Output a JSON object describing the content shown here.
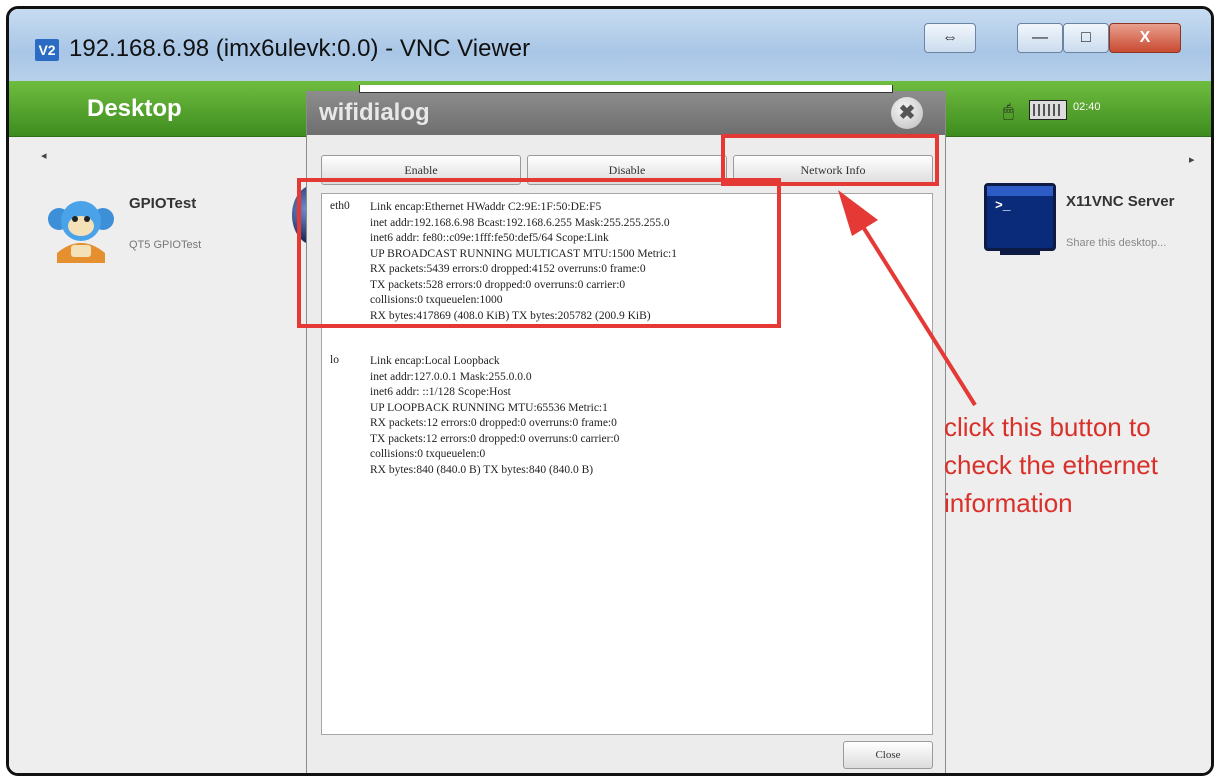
{
  "window": {
    "app_icon": "V2",
    "title": "192.168.6.98 (imx6ulevk:0.0) - VNC Viewer",
    "controls": {
      "resize": "⇔",
      "minimize": "—",
      "maximize": "□",
      "close": "X"
    }
  },
  "desktop": {
    "title": "Desktop",
    "clock": "02:40",
    "nav_left": "◂",
    "nav_right": "▸",
    "apps": [
      {
        "name": "GPIOTest",
        "description": "QT5 GPIOTest",
        "icon": "monkey-icon"
      },
      {
        "name": "X11VNC Server",
        "description": "Share this desktop...",
        "icon": "terminal-icon"
      }
    ]
  },
  "dialog": {
    "title": "wifidialog",
    "buttons": {
      "enable": "Enable",
      "disable": "Disable",
      "network_info": "Network Info",
      "close": "Close"
    },
    "interfaces": [
      {
        "name": "eth0",
        "lines": [
          "Link encap:Ethernet  HWaddr C2:9E:1F:50:DE:F5",
          "inet addr:192.168.6.98  Bcast:192.168.6.255  Mask:255.255.255.0",
          "inet6 addr: fe80::c09e:1fff:fe50:def5/64 Scope:Link",
          "UP BROADCAST RUNNING MULTICAST  MTU:1500  Metric:1",
          "RX packets:5439 errors:0 dropped:4152 overruns:0 frame:0",
          "TX packets:528 errors:0 dropped:0 overruns:0 carrier:0",
          "collisions:0 txqueuelen:1000",
          "RX bytes:417869 (408.0 KiB)  TX bytes:205782 (200.9 KiB)"
        ]
      },
      {
        "name": "lo",
        "lines": [
          "Link encap:Local Loopback",
          "inet addr:127.0.0.1  Mask:255.0.0.0",
          "inet6 addr: ::1/128 Scope:Host",
          "UP LOOPBACK RUNNING  MTU:65536  Metric:1",
          "RX packets:12 errors:0 dropped:0 overruns:0 frame:0",
          "TX packets:12 errors:0 dropped:0 overruns:0 carrier:0",
          "collisions:0 txqueuelen:0",
          "RX bytes:840 (840.0 B)  TX bytes:840 (840.0 B)"
        ]
      }
    ]
  },
  "annotation": {
    "lines": [
      "click this button to",
      "check the ethernet",
      "information"
    ],
    "color": "#e53935"
  }
}
